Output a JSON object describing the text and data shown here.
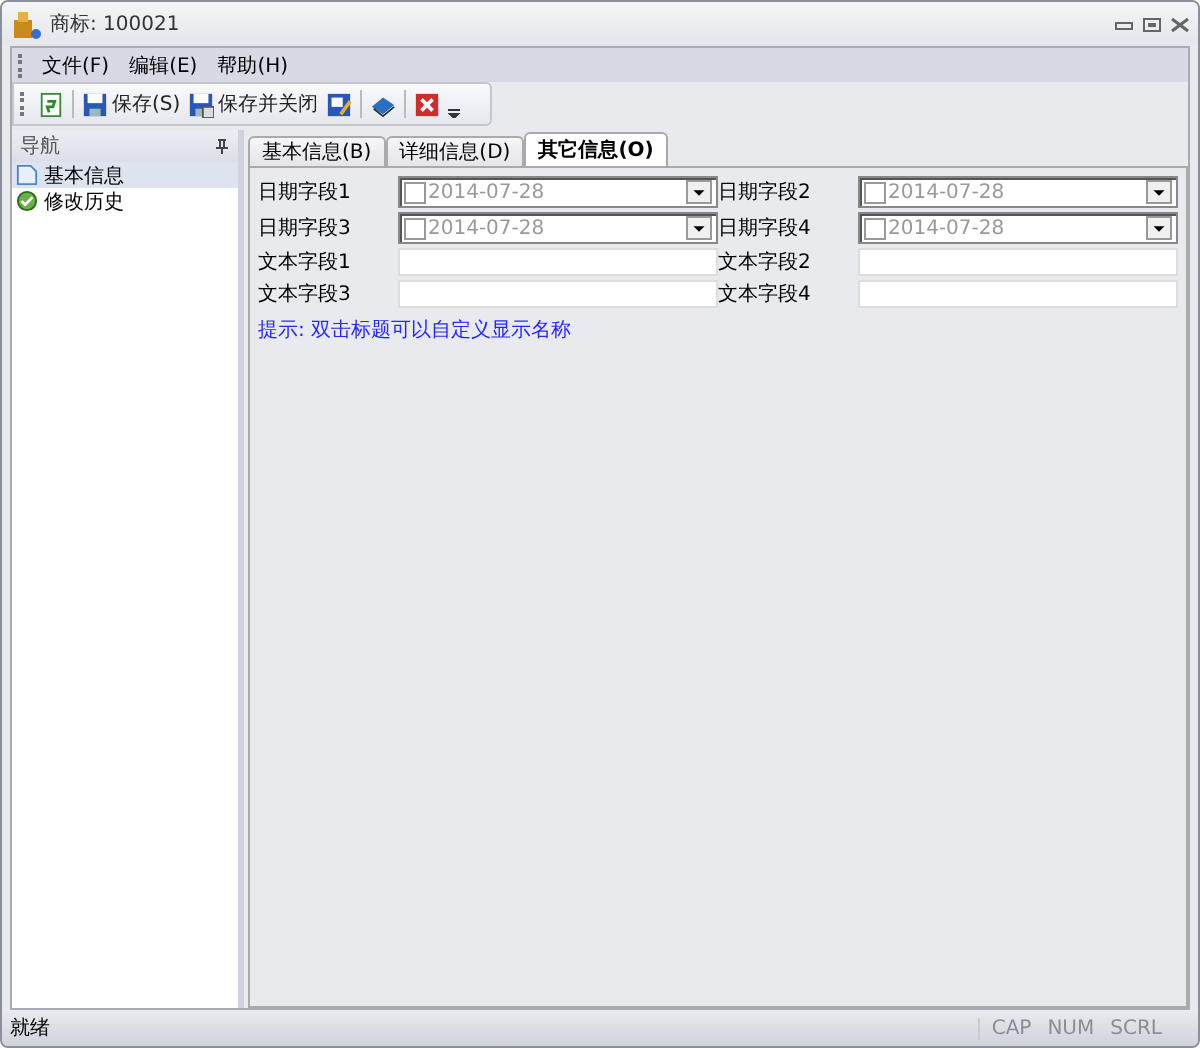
{
  "window": {
    "title": "商标: 100021"
  },
  "menu": [
    "文件(F)",
    "编辑(E)",
    "帮助(H)"
  ],
  "toolbar": [
    {
      "kind": "refresh"
    },
    {
      "kind": "save",
      "label": "保存(S)"
    },
    {
      "kind": "save-close",
      "label": "保存并关闭"
    },
    {
      "kind": "edit"
    },
    {
      "kind": "book"
    },
    {
      "kind": "close"
    }
  ],
  "sidebar": {
    "title": "导航",
    "items": [
      {
        "label": "基本信息",
        "kind": "page",
        "selected": true
      },
      {
        "label": "修改历史",
        "kind": "history",
        "selected": false
      }
    ]
  },
  "tabs": [
    {
      "label": "基本信息(B)",
      "selected": false
    },
    {
      "label": "详细信息(D)",
      "selected": false
    },
    {
      "label": "其它信息(O)",
      "selected": true
    }
  ],
  "fields": [
    {
      "label": "日期字段1",
      "kind": "date",
      "value": "2014-07-28",
      "checked": false
    },
    {
      "label": "日期字段2",
      "kind": "date",
      "value": "2014-07-28",
      "checked": false
    },
    {
      "label": "日期字段3",
      "kind": "date",
      "value": "2014-07-28",
      "checked": false
    },
    {
      "label": "日期字段4",
      "kind": "date",
      "value": "2014-07-28",
      "checked": false
    },
    {
      "label": "文本字段1",
      "kind": "text"
    },
    {
      "label": "文本字段2",
      "kind": "text"
    },
    {
      "label": "文本字段3",
      "kind": "text"
    },
    {
      "label": "文本字段4",
      "kind": "text"
    }
  ],
  "hint": "提示: 双击标题可以自定义显示名称",
  "status_bar": {
    "text": "就绪",
    "indicators": [
      {
        "label": "CAP",
        "on": false
      },
      {
        "label": "NUM",
        "on": false
      },
      {
        "label": "SCRL",
        "on": false
      }
    ]
  }
}
